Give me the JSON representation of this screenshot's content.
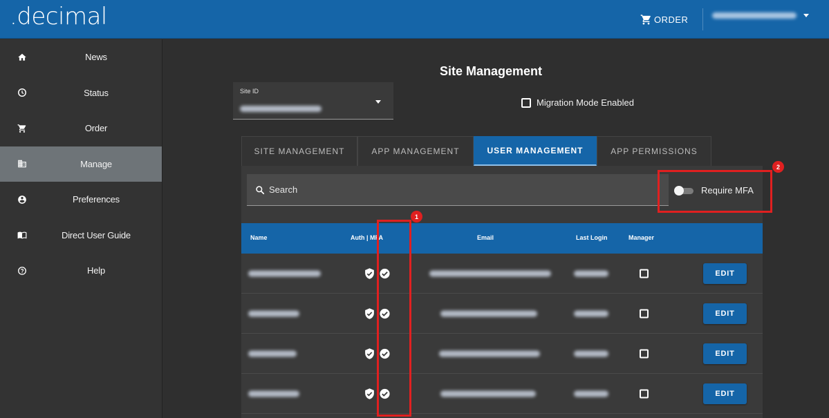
{
  "header": {
    "logo": ".decimal",
    "order_label": "ORDER",
    "user_name_redacted": true
  },
  "sidebar": {
    "items": [
      {
        "label": "News",
        "icon": "home-icon",
        "active": false
      },
      {
        "label": "Status",
        "icon": "clock-icon",
        "active": false
      },
      {
        "label": "Order",
        "icon": "cart-icon",
        "active": false
      },
      {
        "label": "Manage",
        "icon": "building-icon",
        "active": true
      },
      {
        "label": "Preferences",
        "icon": "account-icon",
        "active": false
      },
      {
        "label": "Direct User Guide",
        "icon": "book-icon",
        "active": false
      },
      {
        "label": "Help",
        "icon": "help-icon",
        "active": false
      }
    ]
  },
  "main": {
    "title": "Site Management",
    "site_select": {
      "label": "Site ID",
      "value_redacted": true
    },
    "migration": {
      "label": "Migration Mode Enabled",
      "checked": false
    },
    "tabs": [
      {
        "label": "SITE MANAGEMENT",
        "active": false
      },
      {
        "label": "APP MANAGEMENT",
        "active": false
      },
      {
        "label": "USER MANAGEMENT",
        "active": true
      },
      {
        "label": "APP PERMISSIONS",
        "active": false
      }
    ],
    "search_placeholder": "Search",
    "require_mfa": {
      "label": "Require MFA",
      "enabled": false
    },
    "table": {
      "columns": [
        "Name",
        "Auth",
        "MFA",
        "Email",
        "Last Login",
        "Manager"
      ],
      "rows": [
        {
          "manager": false,
          "edit_label": "EDIT"
        },
        {
          "manager": false,
          "edit_label": "EDIT"
        },
        {
          "manager": false,
          "edit_label": "EDIT"
        },
        {
          "manager": false,
          "edit_label": "EDIT"
        }
      ]
    }
  },
  "annotations": [
    {
      "number": "1"
    },
    {
      "number": "2"
    }
  ],
  "colors": {
    "primary": "#1565a8",
    "background": "#2f2f2f",
    "sidebar": "#333333",
    "active_nav": "#6e7478",
    "annotation": "#e02020"
  }
}
